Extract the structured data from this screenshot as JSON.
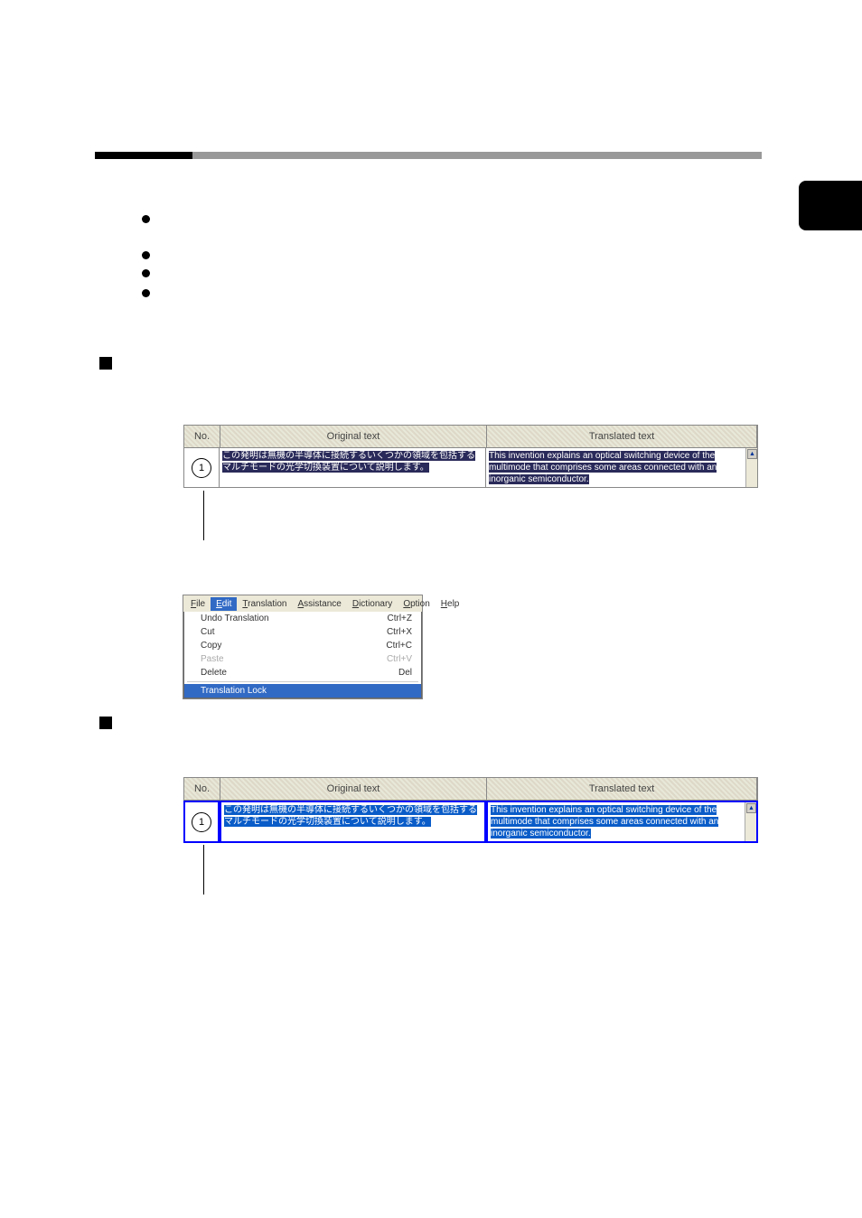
{
  "table": {
    "header_no": "No.",
    "header_original": "Original text",
    "header_translated": "Translated text",
    "row_number": "1",
    "original_text": "この発明は無機の半導体に接続するいくつかの領域を包括するマルチモードの光学切換装置について説明します。",
    "translated_text": "This invention explains an optical switching device of the multimode that comprises some areas connected with an inorganic semiconductor."
  },
  "menu": {
    "file": "File",
    "edit": "Edit",
    "translation": "Translation",
    "assistance": "Assistance",
    "dictionary": "Dictionary",
    "option": "Option",
    "help": "Help",
    "undo_translation": "Undo Translation",
    "undo_shortcut": "Ctrl+Z",
    "cut": "Cut",
    "cut_shortcut": "Ctrl+X",
    "copy": "Copy",
    "copy_shortcut": "Ctrl+C",
    "paste": "Paste",
    "paste_shortcut": "Ctrl+V",
    "delete": "Delete",
    "delete_shortcut": "Del",
    "translation_lock": "Translation Lock"
  }
}
